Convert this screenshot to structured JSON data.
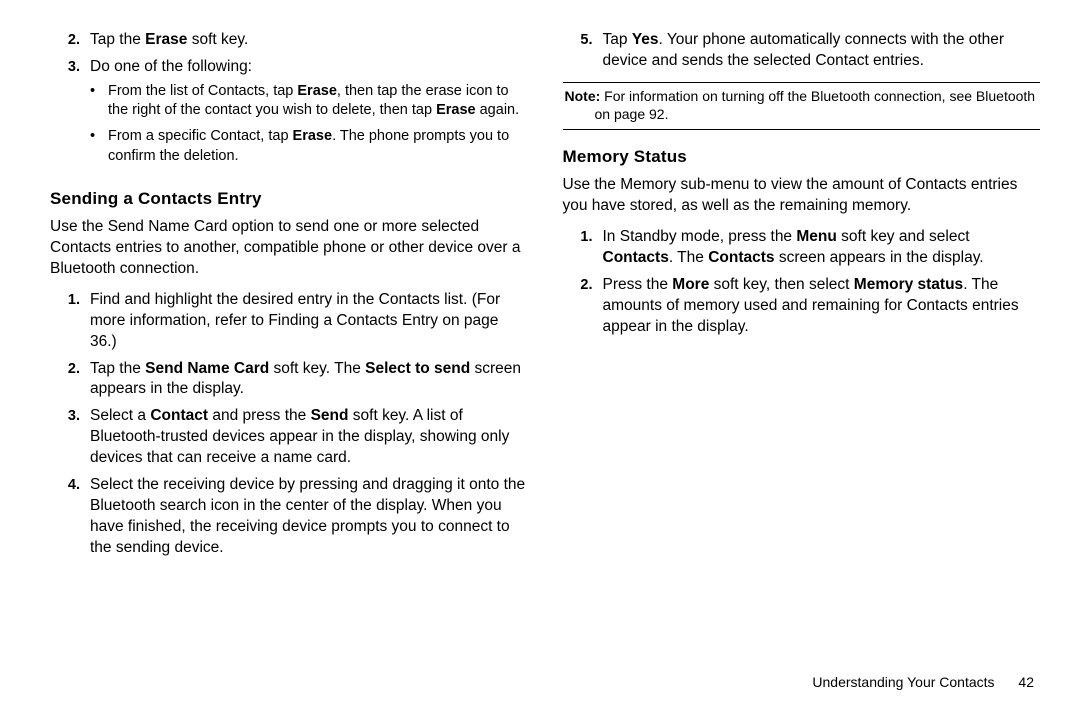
{
  "left": {
    "item2_num": "2.",
    "item2_pre": "Tap the ",
    "item2_b": "Erase",
    "item2_post": " soft key.",
    "item3_num": "3.",
    "item3_text": "Do one of the following:",
    "b1_pre": "From the list of Contacts, tap ",
    "b1_b1": "Erase",
    "b1_mid": ", then tap the erase icon to the right of the contact you wish to delete, then tap ",
    "b1_b2": "Erase",
    "b1_post": " again.",
    "b2_pre": "From a specific Contact, tap ",
    "b2_b": "Erase",
    "b2_post": ". The phone prompts you to confirm the deletion.",
    "h_send": "Sending a Contacts Entry",
    "send_intro": "Use the Send Name Card option to send one or more selected Contacts entries to another, compatible phone or other device over a Bluetooth connection.",
    "s1_num": "1.",
    "s1_text": "Find and highlight the desired entry in the Contacts list. (For more information, refer to  Finding a Contacts Entry on page 36.)",
    "s2_num": "2.",
    "s2_pre": "Tap the ",
    "s2_b1": "Send Name Card",
    "s2_mid": " soft key. The ",
    "s2_b2": "Select to send",
    "s2_post": " screen appears in the display.",
    "s3_num": "3.",
    "s3_pre": "Select a ",
    "s3_b1": "Contact",
    "s3_mid": " and press the ",
    "s3_b2": "Send",
    "s3_post": " soft key. A list of Bluetooth-trusted devices appear in the display, showing only devices that can receive a name card.",
    "s4_num": "4.",
    "s4_text": "Select the receiving device by pressing and dragging it onto the Bluetooth search icon in the center of the display. When you have finished, the receiving device prompts you to connect to the sending device."
  },
  "right": {
    "r5_num": "5.",
    "r5_pre": "Tap ",
    "r5_b": "Yes",
    "r5_post": ". Your phone automatically connects with the other device and sends the selected Contact entries.",
    "note_label": "Note:",
    "note_text": " For information on turning off the Bluetooth connection, see Bluetooth on page 92.",
    "h_mem": "Memory Status",
    "mem_intro": "Use the Memory sub-menu to view the amount of Contacts entries you have stored, as well as the remaining memory.",
    "m1_num": "1.",
    "m1_pre": "In Standby mode, press the ",
    "m1_b1": "Menu",
    "m1_mid": " soft key and select ",
    "m1_b2": "Contacts",
    "m1_mid2": ". The ",
    "m1_b3": "Contacts",
    "m1_post": " screen appears in the display.",
    "m2_num": "2.",
    "m2_pre": "Press the ",
    "m2_b1": "More",
    "m2_mid": " soft key, then select ",
    "m2_b2": "Memory status",
    "m2_post": ". The amounts of memory used and remaining for Contacts entries appear in the display."
  },
  "footer": {
    "section": "Understanding Your Contacts",
    "page": "42"
  }
}
